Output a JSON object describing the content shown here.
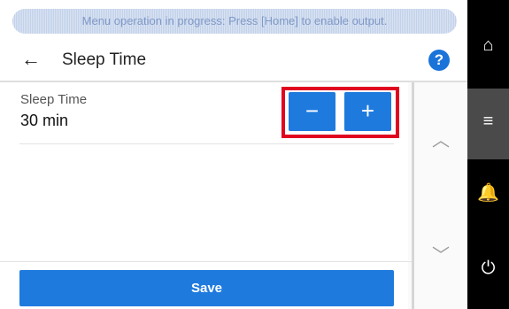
{
  "banner": {
    "message": "Menu operation in progress: Press [Home] to enable output."
  },
  "header": {
    "back_icon": "←",
    "title": "Sleep Time",
    "help_icon": "?"
  },
  "setting": {
    "label": "Sleep Time",
    "value": "30 min",
    "minus_label": "−",
    "plus_label": "+"
  },
  "scroll": {
    "up_icon": "︿",
    "down_icon": "﹀"
  },
  "footer": {
    "save_label": "Save"
  },
  "sidebar": {
    "home_icon": "⌂",
    "menu_icon": "≡",
    "bell_icon": "🔔",
    "power_icon": "⏻",
    "active": "menu"
  },
  "colors": {
    "accent": "#1f7ade",
    "highlight_frame": "#e0061f",
    "sidebar": "#000000"
  }
}
